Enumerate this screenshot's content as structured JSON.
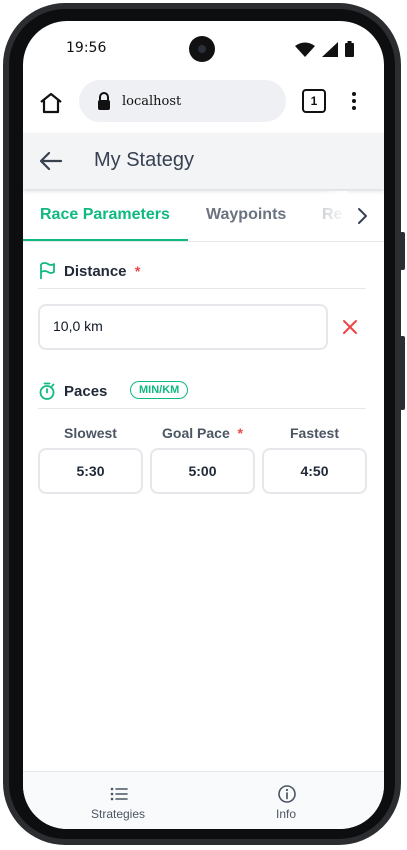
{
  "status_bar": {
    "time": "19:56"
  },
  "browser": {
    "url": "localhost",
    "tab_count": "1"
  },
  "header": {
    "title": "My Stategy"
  },
  "tabs": [
    {
      "label": "Race Parameters",
      "active": true
    },
    {
      "label": "Waypoints",
      "active": false
    },
    {
      "label": "Re",
      "active": false
    }
  ],
  "distance": {
    "label": "Distance",
    "required_mark": "*",
    "value": "10,0 km"
  },
  "paces": {
    "label": "Paces",
    "unit_badge": "MIN/KM",
    "required_mark": "*",
    "columns": [
      {
        "label": "Slowest",
        "value": "5:30",
        "required": false
      },
      {
        "label": "Goal Pace",
        "value": "5:00",
        "required": true
      },
      {
        "label": "Fastest",
        "value": "4:50",
        "required": false
      }
    ]
  },
  "bottom_nav": [
    {
      "label": "Strategies",
      "icon": "list-icon"
    },
    {
      "label": "Info",
      "icon": "info-icon"
    }
  ],
  "colors": {
    "accent": "#10b981",
    "required": "#ef4444",
    "header_bg": "#f3f4f6"
  }
}
